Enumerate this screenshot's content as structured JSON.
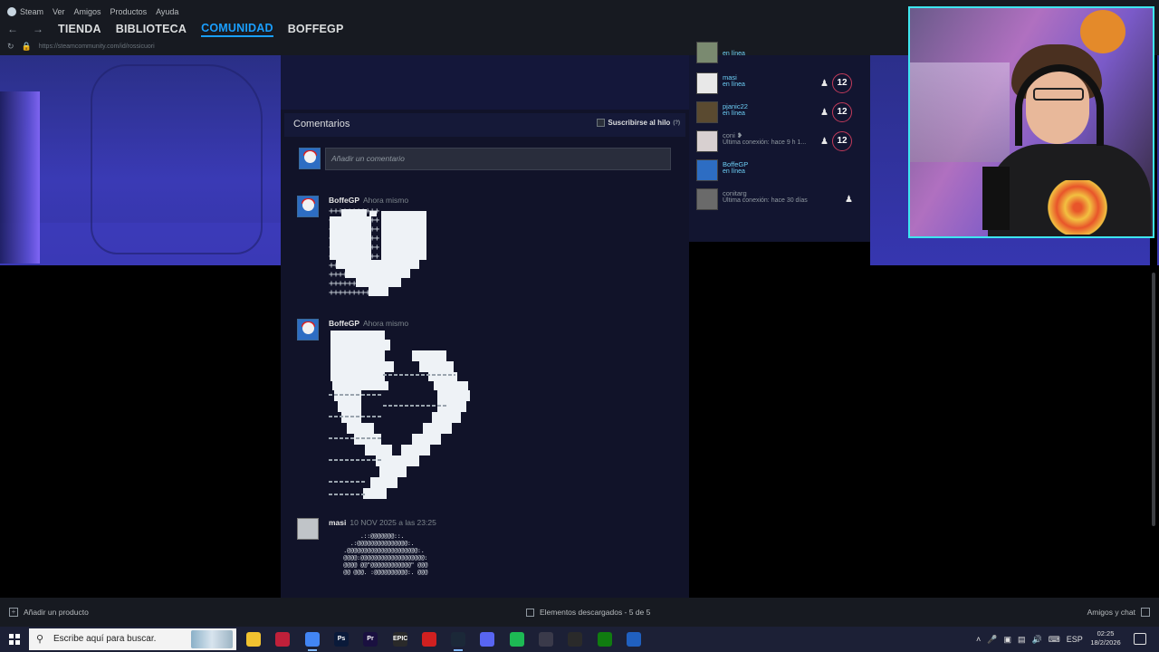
{
  "menu": {
    "app": "Steam",
    "items": [
      "Ver",
      "Amigos",
      "Productos",
      "Ayuda"
    ]
  },
  "nav": {
    "tabs": [
      "TIENDA",
      "BIBLIOTECA",
      "COMUNIDAD",
      "BOFFEGP"
    ],
    "active": "COMUNIDAD",
    "url": "https://steamcommunity.com/id/rossicuori"
  },
  "thread": {
    "title": "Comentarios",
    "subscribe_label": "Suscribirse al hilo",
    "help_marker": "(?)",
    "input_placeholder": "Añadir un comentario",
    "comments": [
      {
        "author": "BoffeGP",
        "time": "Ahora mismo"
      },
      {
        "author": "BoffeGP",
        "time": "Ahora mismo"
      },
      {
        "author": "masi",
        "time": "10 NOV 2025 a las 23:25"
      }
    ]
  },
  "friends": [
    {
      "name": "masi",
      "status": "en línea",
      "count": "12",
      "online": true,
      "avatar": "#e8e8e8"
    },
    {
      "name": "pjanic22",
      "status": "en línea",
      "count": "12",
      "online": true,
      "avatar": "#5a4a30"
    },
    {
      "name": "coni ❥",
      "status": "Última conexión: hace 9 h 1...",
      "count": "12",
      "online": false,
      "avatar": "#d8d0d0"
    },
    {
      "name": "BoffeGP",
      "status": "en línea",
      "count": "",
      "online": true,
      "avatar": "#2d6dc3"
    },
    {
      "name": "conitarg",
      "status": "Última conexión: hace 30 días",
      "count": "",
      "online": false,
      "avatar": "#6a6a6a"
    }
  ],
  "bottombar": {
    "add_product": "Añadir un producto",
    "downloads": "Elementos descargados - 5 de 5",
    "friends_chat": "Amigos y chat"
  },
  "taskbar": {
    "search_placeholder": "Escribe aquí para buscar.",
    "language": "ESP",
    "time": "02:25",
    "date": "18/2/2026",
    "apps": [
      {
        "name": "file-explorer-icon",
        "color": "#f2c230",
        "label": ""
      },
      {
        "name": "opera-gx-icon",
        "color": "#c0203a",
        "label": ""
      },
      {
        "name": "chrome-icon",
        "color": "#4285f4",
        "label": ""
      },
      {
        "name": "photoshop-icon",
        "color": "#0a1a3a",
        "label": "Ps"
      },
      {
        "name": "premiere-icon",
        "color": "#1a1040",
        "label": "Pr"
      },
      {
        "name": "epic-games-icon",
        "color": "#2a2a2a",
        "label": "EPIC"
      },
      {
        "name": "red-app-icon",
        "color": "#d02020",
        "label": ""
      },
      {
        "name": "steam-icon",
        "color": "#1b2838",
        "label": ""
      },
      {
        "name": "discord-icon",
        "color": "#5865f2",
        "label": ""
      },
      {
        "name": "spotify-icon",
        "color": "#1db954",
        "label": ""
      },
      {
        "name": "app-icon",
        "color": "#3a3a4a",
        "label": ""
      },
      {
        "name": "obs-icon",
        "color": "#2a2a2a",
        "label": ""
      },
      {
        "name": "xbox-icon",
        "color": "#107c10",
        "label": ""
      },
      {
        "name": "app2-icon",
        "color": "#2060c0",
        "label": ""
      }
    ]
  }
}
